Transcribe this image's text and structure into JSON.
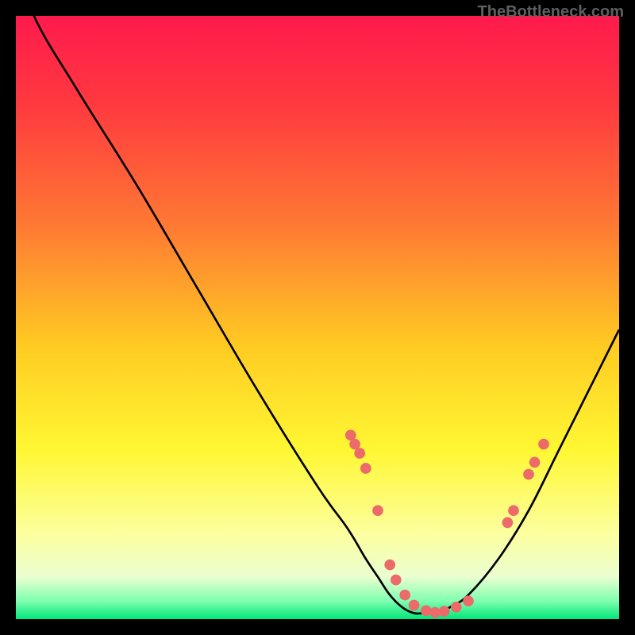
{
  "watermark": "TheBottleneck.com",
  "gradient": {
    "stops": [
      {
        "pos": 0.0,
        "color": "#ff1a4d"
      },
      {
        "pos": 0.15,
        "color": "#ff3a3f"
      },
      {
        "pos": 0.35,
        "color": "#ff7a33"
      },
      {
        "pos": 0.55,
        "color": "#ffcc22"
      },
      {
        "pos": 0.72,
        "color": "#fff733"
      },
      {
        "pos": 0.86,
        "color": "#fcffa0"
      },
      {
        "pos": 0.93,
        "color": "#eaffd0"
      },
      {
        "pos": 0.97,
        "color": "#7fffb0"
      },
      {
        "pos": 1.0,
        "color": "#00e67a"
      }
    ]
  },
  "chart_data": {
    "type": "line",
    "title": "",
    "xlabel": "",
    "ylabel": "",
    "xlim": [
      0,
      100
    ],
    "ylim": [
      0,
      100
    ],
    "series": [
      {
        "name": "curve",
        "x": [
          0,
          3,
          10,
          20,
          30,
          40,
          50,
          55,
          58,
          60,
          62,
          64,
          66,
          68,
          70,
          72,
          75,
          80,
          85,
          90,
          95,
          100
        ],
        "y": [
          110,
          100,
          88,
          72,
          55,
          38,
          22,
          15,
          10,
          7,
          4,
          2,
          1,
          1,
          1,
          2,
          4,
          10,
          18,
          28,
          38,
          48
        ]
      }
    ],
    "markers": {
      "name": "points",
      "color": "#ec6a6a",
      "x": [
        55.5,
        56.2,
        57.0,
        58.0,
        60.0,
        62.0,
        63.0,
        64.5,
        66.0,
        68.0,
        69.5,
        71.0,
        73.0,
        75.0,
        81.5,
        82.5,
        85.0,
        86.0,
        87.5
      ],
      "y": [
        30.5,
        29.0,
        27.5,
        25.0,
        18.0,
        9.0,
        6.5,
        4.0,
        2.3,
        1.4,
        1.1,
        1.3,
        2.0,
        3.0,
        16.0,
        18.0,
        24.0,
        26.0,
        29.0
      ]
    }
  }
}
